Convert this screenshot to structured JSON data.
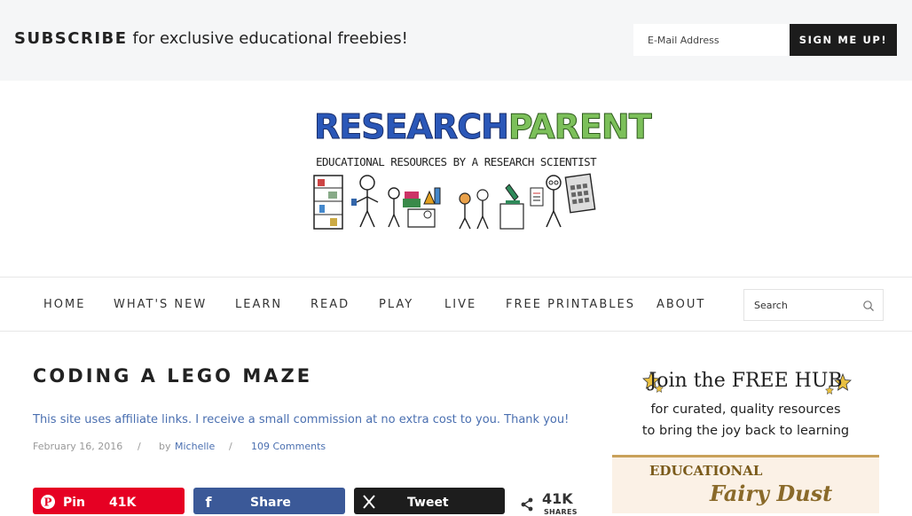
{
  "subscribe": {
    "strong": "SUBSCRIBE",
    "text": "for exclusive educational freebies!",
    "email_placeholder": "E-Mail Address",
    "button": "SIGN ME UP!"
  },
  "logo": {
    "part1": "RESEARCH",
    "part2": "PARENT",
    "tagline": "EDUCATIONAL RESOURCES BY A RESEARCH SCIENTIST"
  },
  "nav": {
    "items": [
      {
        "label": "HOME"
      },
      {
        "label": "WHAT'S NEW"
      },
      {
        "label": "LEARN"
      },
      {
        "label": "READ"
      },
      {
        "label": "PLAY"
      },
      {
        "label": "LIVE"
      },
      {
        "label": "FREE PRINTABLES"
      },
      {
        "label": "ABOUT"
      }
    ],
    "search_placeholder": "Search",
    "search_icon": "magnifier-icon"
  },
  "post": {
    "title": "CODING A LEGO MAZE",
    "disclosure": "This site uses affiliate links. I receive a small commission at no extra cost to you. Thank you!",
    "date": "February 16, 2016",
    "sep": "/",
    "by": "by",
    "author": "Michelle",
    "comments": "109 Comments"
  },
  "share": {
    "pin_label": "Pin",
    "pin_count": "41K",
    "fb_label": "Share",
    "tw_label": "Tweet",
    "total": "41K",
    "total_label": "SHARES",
    "colors": {
      "pinterest": "#e60023",
      "facebook": "#3b5998",
      "x": "#1d1d1d"
    }
  },
  "sidebar_ad": {
    "line1": "Join the FREE HUB",
    "line2": "for curated, quality resources",
    "line3": "to bring the joy back to learning",
    "edu": "EDUCATIONAL",
    "fairy": "Fairy Dust"
  }
}
